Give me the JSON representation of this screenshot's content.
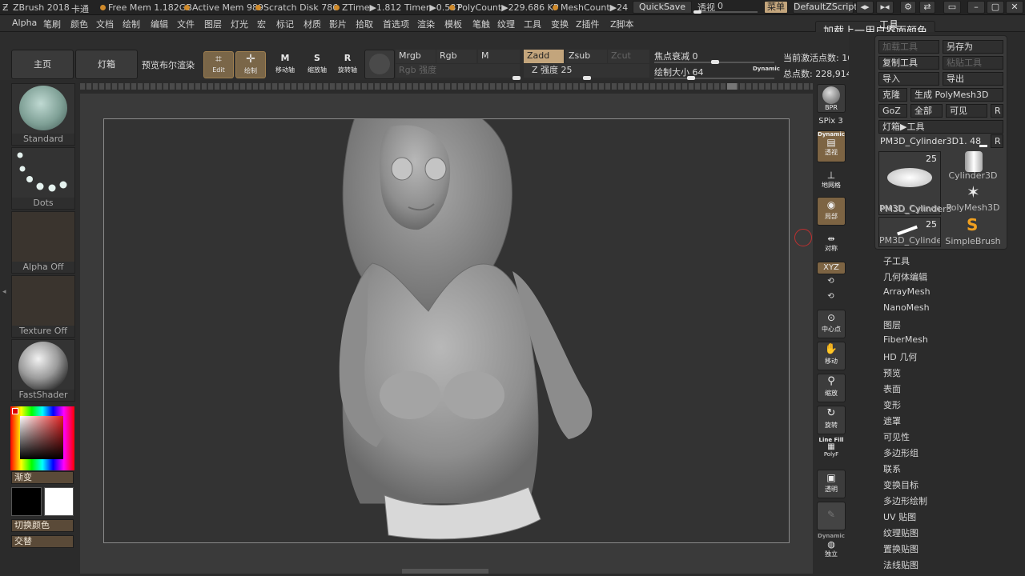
{
  "titlebar": {
    "app": "ZBrush 2018",
    "mode": "卡通",
    "free_mem": "Free Mem 1.182GB",
    "active_mem": "Active Mem 989",
    "scratch_disk": "Scratch Disk 786",
    "ztime": "ZTime▶1.812 Timer▶0.587",
    "polycount": "PolyCount▶229.686 KP",
    "meshcount": "MeshCount▶24",
    "quicksave": "QuickSave",
    "transparency_label": "透视",
    "transparency_value": "0",
    "menu_btn": "菜单",
    "script_btn": "DefaultZScript"
  },
  "menubar": [
    "Alpha",
    "笔刷",
    "颜色",
    "文档",
    "绘制",
    "编辑",
    "文件",
    "图层",
    "灯光",
    "宏",
    "标记",
    "材质",
    "影片",
    "拾取",
    "首选项",
    "渲染",
    "模板",
    "笔触",
    "纹理",
    "工具",
    "变换",
    "Z插件",
    "Z脚本"
  ],
  "shelf": {
    "home": "主页",
    "lightbox": "灯箱",
    "bpr_preview": "预览布尔渲染",
    "edit": "Edit",
    "draw": "绘制",
    "move": "移动轴",
    "scale": "缩放轴",
    "rotate": "旋转轴",
    "mrgb": "Mrgb",
    "rgb": "Rgb",
    "m": "M",
    "zadd": "Zadd",
    "zsub": "Zsub",
    "zcut": "Zcut",
    "rgb_intensity": "Rgb 强度",
    "z_intensity_label": "Z 强度",
    "z_intensity_value": "25",
    "focal_label": "焦点衰减",
    "focal_value": "0",
    "draw_size_label": "绘制大小",
    "draw_size_value": "64",
    "dynamic": "Dynamic",
    "active_points": "当前激活点数: 16,",
    "total_points": "总点数: 228,914"
  },
  "lefttray": {
    "brush": "Standard",
    "stroke": "Dots",
    "alpha": "Alpha Off",
    "texture": "Texture Off",
    "material": "FastShader",
    "gradient": "渐变",
    "switch_color": "切换颜色",
    "alternate": "交替"
  },
  "righttool": {
    "bpr": "BPR",
    "spix_label": "SPix",
    "spix_value": "3",
    "persp": "透视",
    "dynamic": "Dynamic",
    "floor": "地网格",
    "local": "局部",
    "symmetry": "对称",
    "xyz": "XYZ",
    "center": "中心点",
    "move": "移动",
    "zoom": "缩放",
    "rotate": "旋转",
    "linefill": "Line Fill",
    "polyf": "PolyF",
    "transp": "透明",
    "solo": "独立",
    "dynamic2": "Dynamic"
  },
  "tooltip": "加载上一用户界面颜色",
  "toolpanel": {
    "title": "工具",
    "load_tool": "加载工具",
    "save_as": "另存为",
    "copy_tool": "复制工具",
    "paste_tool": "粘贴工具",
    "import": "导入",
    "export": "导出",
    "clone": "克隆",
    "make_polymesh": "生成 PolyMesh3D",
    "goz": "GoZ",
    "all": "全部",
    "visible": "可见",
    "r": "R",
    "lightbox_tools": "灯箱▶工具",
    "current_tool": "PM3D_Cylinder3D1. 48",
    "thumbs": [
      {
        "label": "PM3D_Cylinder3",
        "count": "25"
      },
      {
        "label": "Cylinder3D",
        "count": ""
      },
      {
        "label": "PM3D_Cylinder3",
        "count": ""
      },
      {
        "label": "PolyMesh3D",
        "count": ""
      },
      {
        "label": "PM3D_Cylinder3",
        "count": "25"
      },
      {
        "label": "SimpleBrush",
        "count": ""
      }
    ]
  },
  "subpalettes": [
    "子工具",
    "几何体编辑",
    "ArrayMesh",
    "NanoMesh",
    "图层",
    "FiberMesh",
    "HD 几何",
    "预览",
    "表面",
    "变形",
    "遮罩",
    "可见性",
    "多边形组",
    "联系",
    "变换目标",
    "多边形绘制",
    "UV 贴图",
    "纹理贴图",
    "置换贴图",
    "法线贴图"
  ],
  "colors": {
    "accent": "#c3a57c",
    "active_button": "#7a6648",
    "canvas": "#333333",
    "model": "#9a9a9a"
  }
}
